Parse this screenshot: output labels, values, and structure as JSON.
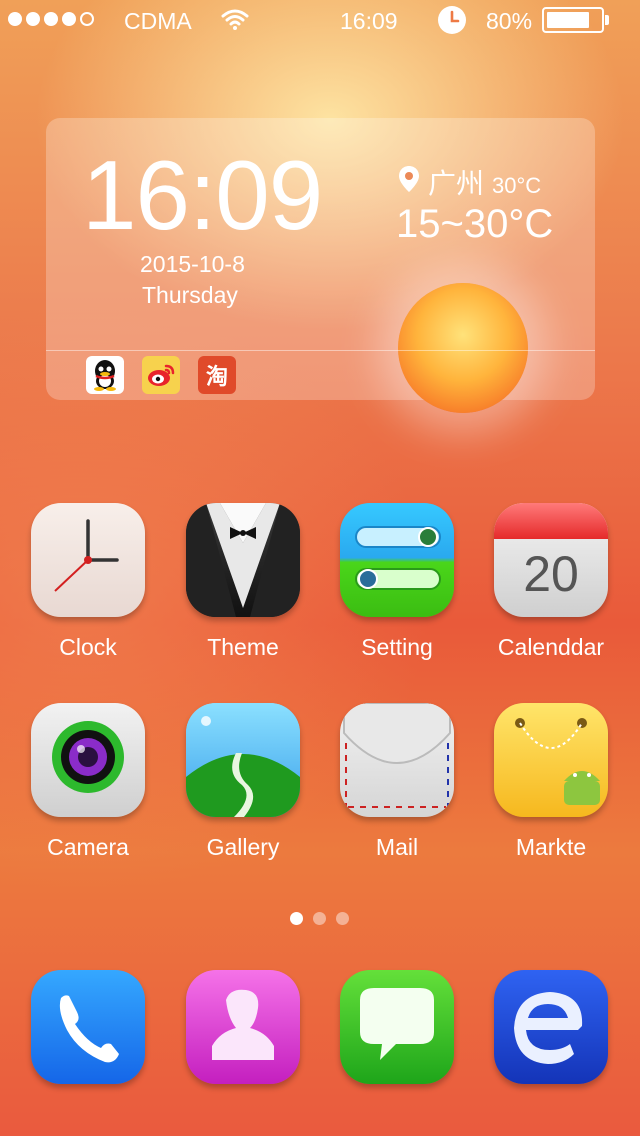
{
  "status_bar": {
    "signal_dots_filled": 4,
    "signal_dots_total": 5,
    "carrier": "CDMA",
    "time": "16:09",
    "battery_percent_label": "80%",
    "battery_level": 0.8,
    "icons": [
      "wifi-icon",
      "alarm-icon",
      "battery-icon"
    ]
  },
  "widget": {
    "time": "16:09",
    "date": "2015-10-8",
    "weekday": "Thursday",
    "city": "广州",
    "current_temp": "30°C",
    "temp_range": "15~30°C",
    "shortcuts": [
      "qq-icon",
      "weibo-icon",
      "taobao-icon"
    ],
    "taobao_glyph": "淘"
  },
  "apps": [
    {
      "label": "Clock",
      "icon": "clock-icon"
    },
    {
      "label": "Theme",
      "icon": "tuxedo-icon"
    },
    {
      "label": "Setting",
      "icon": "toggle-sliders-icon"
    },
    {
      "label": "Calenddar",
      "icon": "calendar-icon",
      "day": "20"
    },
    {
      "label": "Camera",
      "icon": "camera-lens-icon"
    },
    {
      "label": "Gallery",
      "icon": "landscape-icon"
    },
    {
      "label": "Mail",
      "icon": "envelope-icon"
    },
    {
      "label": "Markte",
      "icon": "shopping-bag-android-icon"
    }
  ],
  "pager": {
    "pages": 3,
    "active": 1
  },
  "dock": [
    {
      "icon": "phone-icon"
    },
    {
      "icon": "contacts-icon"
    },
    {
      "icon": "message-bubble-icon"
    },
    {
      "icon": "browser-e-icon"
    }
  ],
  "colors": {
    "background_top": "#f0a058",
    "background_bottom": "#ea5a3e",
    "text": "#ffffff"
  }
}
